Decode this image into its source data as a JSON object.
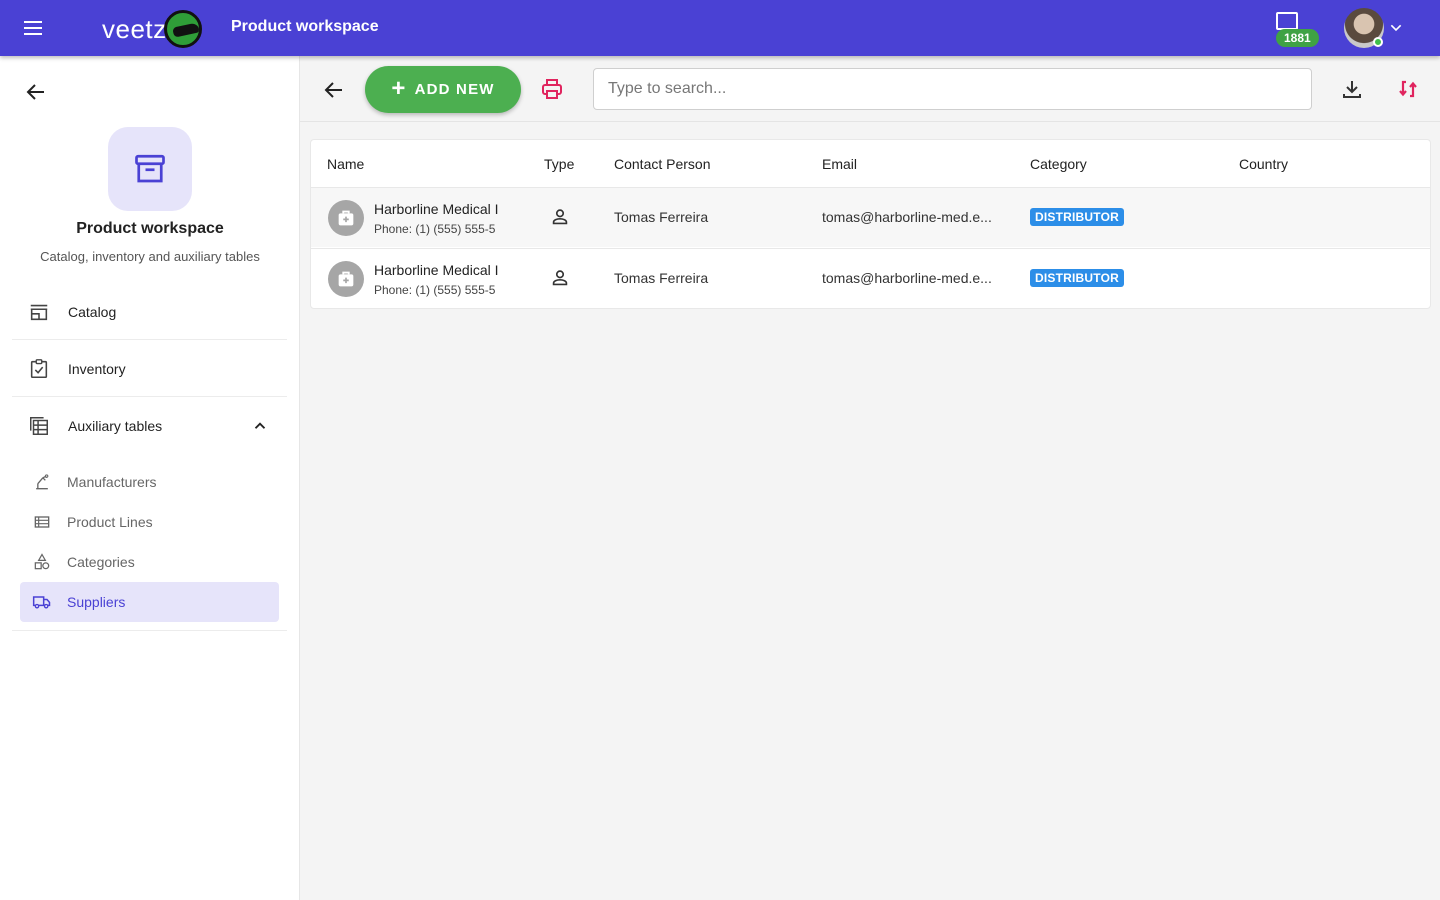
{
  "header": {
    "logo_text": "veetz",
    "title": "Product workspace",
    "notifications_count": "1881",
    "menu_icon": "menu-icon",
    "notification_icon": "notification-icon",
    "caret_icon": "chevron-down-icon",
    "brand_color": "#4a41d4"
  },
  "sidebar": {
    "workspace_title": "Product workspace",
    "workspace_subtitle": "Catalog, inventory and auxiliary tables",
    "items": [
      {
        "label": "Catalog",
        "icon": "storefront-icon"
      },
      {
        "label": "Inventory",
        "icon": "clipboard-check-icon"
      },
      {
        "label": "Auxiliary tables",
        "icon": "table-icon",
        "expanded": true
      }
    ],
    "sub_items": [
      {
        "label": "Manufacturers",
        "icon": "factory-icon"
      },
      {
        "label": "Product Lines",
        "icon": "list-icon"
      },
      {
        "label": "Categories",
        "icon": "shapes-icon"
      },
      {
        "label": "Suppliers",
        "icon": "truck-icon",
        "active": true
      }
    ]
  },
  "toolbar": {
    "add_label": "ADD NEW",
    "search_placeholder": "Type to search...",
    "search_value": "",
    "accent_green": "#4caf50",
    "accent_red": "#e0245e"
  },
  "table": {
    "columns": [
      "Name",
      "Type",
      "Contact Person",
      "Email",
      "Category",
      "Country"
    ],
    "rows": [
      {
        "name": "Harborline Medical I",
        "phone": "Phone: (1) (555) 555-5",
        "type_icon": "person-icon",
        "contact": "Tomas Ferreira",
        "email": "tomas@harborline-med.e...",
        "category": "DISTRIBUTOR",
        "country": ""
      },
      {
        "name": "Harborline Medical I",
        "phone": "Phone: (1) (555) 555-5",
        "type_icon": "person-icon",
        "contact": "Tomas Ferreira",
        "email": "tomas@harborline-med.e...",
        "category": "DISTRIBUTOR",
        "country": ""
      }
    ],
    "badge_color": "#2c8ee8"
  }
}
